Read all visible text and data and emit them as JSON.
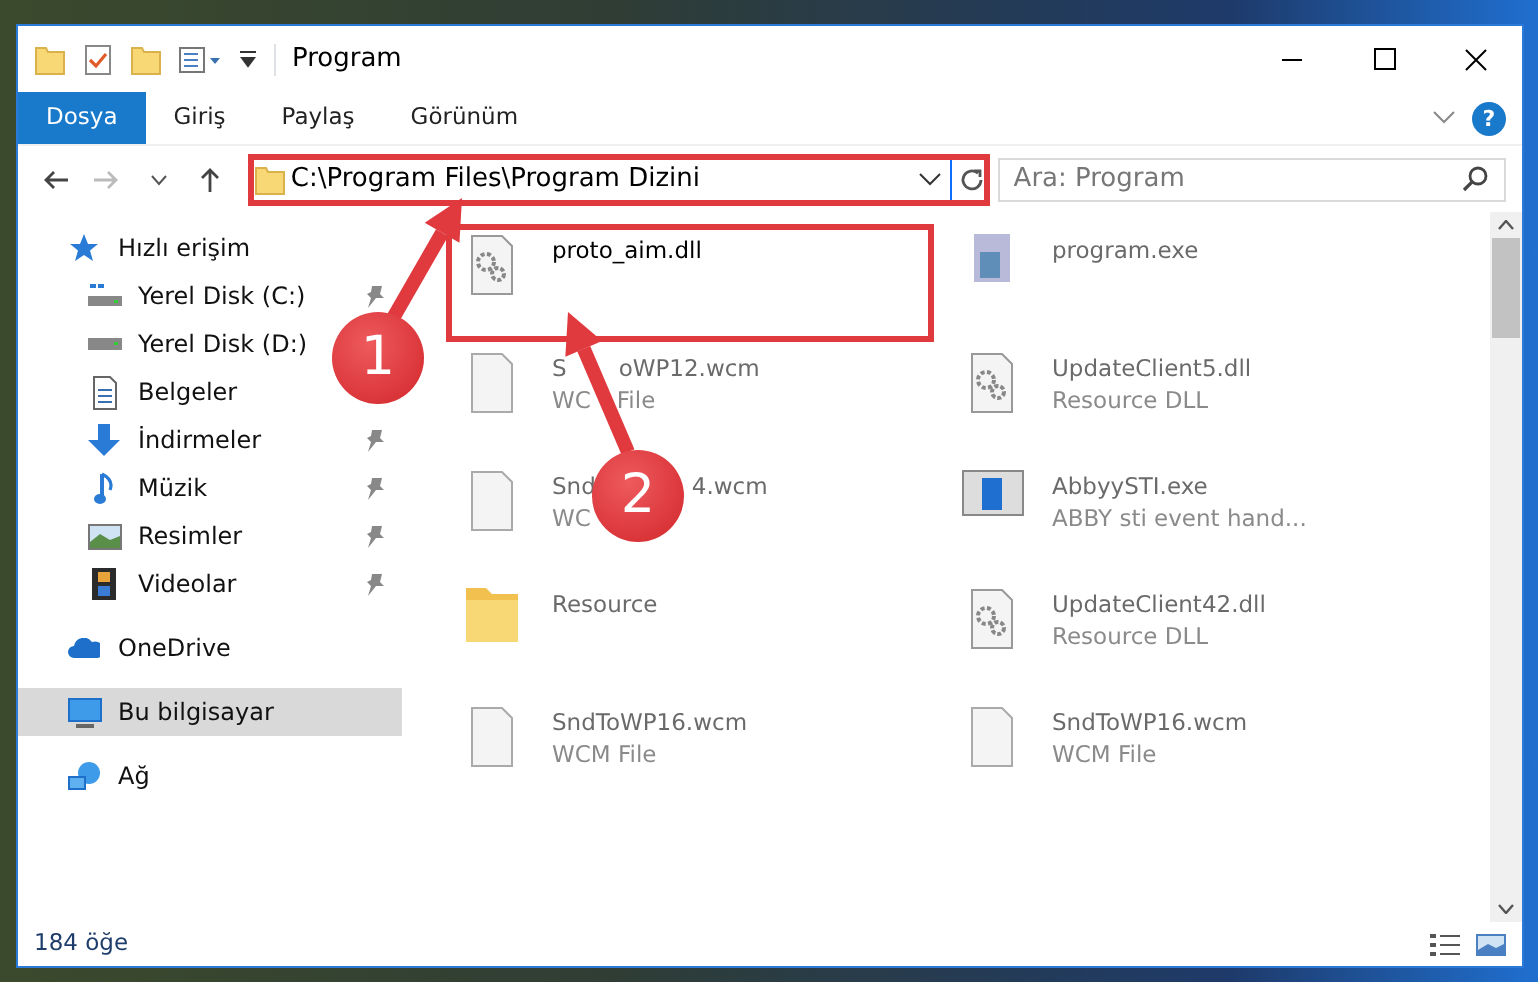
{
  "window": {
    "title": "Program"
  },
  "ribbon_tabs": [
    {
      "label": "Dosya",
      "selected": true
    },
    {
      "label": "Giriş",
      "selected": false
    },
    {
      "label": "Paylaş",
      "selected": false
    },
    {
      "label": "Görünüm",
      "selected": false
    }
  ],
  "help": "?",
  "address": {
    "value": "C:\\Program Files\\Program Dizini",
    "highlighted": true
  },
  "search": {
    "placeholder": "Ara: Program"
  },
  "sidebar": {
    "items": [
      {
        "label": "Hızlı erişim",
        "kind": "star",
        "selected": false,
        "children": [
          {
            "label": "Yerel Disk (C:)",
            "kind": "drive-c",
            "selected": false,
            "pinned": true
          },
          {
            "label": "Yerel Disk (D:)",
            "kind": "drive",
            "selected": false,
            "pinned": false
          },
          {
            "label": "Belgeler",
            "kind": "documents",
            "selected": false,
            "pinned": false
          },
          {
            "label": "İndirmeler",
            "kind": "downloads",
            "selected": false,
            "pinned": true
          },
          {
            "label": "Müzik",
            "kind": "music",
            "selected": false,
            "pinned": true
          },
          {
            "label": "Resimler",
            "kind": "pictures",
            "selected": false,
            "pinned": true
          },
          {
            "label": "Videolar",
            "kind": "videos",
            "selected": false,
            "pinned": true
          }
        ]
      },
      {
        "label": "OneDrive",
        "kind": "cloud",
        "selected": false
      },
      {
        "label": "Bu bilgisayar",
        "kind": "computer",
        "selected": true
      },
      {
        "label": "Ağ",
        "kind": "network",
        "selected": false
      }
    ]
  },
  "files": [
    {
      "name": [
        "proto_aim.dll"
      ],
      "kind": "dll",
      "highlighted": true,
      "blurred": false
    },
    {
      "name": [
        "program.exe"
      ],
      "kind": "setup",
      "highlighted": false,
      "blurred": true
    },
    {
      "name": [
        "S",
        "oWP12.wcm"
      ],
      "type": [
        "WC",
        "File"
      ],
      "kind": "blank",
      "highlighted": false,
      "blurred": true
    },
    {
      "name": [
        "UpdateClient5.dll"
      ],
      "type": [
        "Resource DLL"
      ],
      "kind": "dll",
      "highlighted": false,
      "blurred": true
    },
    {
      "name": [
        "Snd",
        "4.wcm"
      ],
      "type": [
        "WC"
      ],
      "kind": "blank",
      "highlighted": false,
      "blurred": true
    },
    {
      "name": [
        "AbbyySTI.exe"
      ],
      "type": [
        "ABBY sti event hand..."
      ],
      "kind": "app",
      "highlighted": false,
      "blurred": true
    },
    {
      "name": [
        "Resource"
      ],
      "kind": "folder",
      "highlighted": false,
      "blurred": true
    },
    {
      "name": [
        "UpdateClient42.dll"
      ],
      "type": [
        "Resource DLL"
      ],
      "kind": "dll",
      "highlighted": false,
      "blurred": true
    },
    {
      "name": [
        "SndToWP16.wcm"
      ],
      "type": [
        "WCM File"
      ],
      "kind": "blank",
      "highlighted": false,
      "blurred": true
    },
    {
      "name": [
        "SndToWP16.wcm"
      ],
      "type": [
        "WCM File"
      ],
      "kind": "blank",
      "highlighted": false,
      "blurred": true
    }
  ],
  "status_bar": {
    "count": "184 öğe"
  },
  "annotations": [
    {
      "number": "1"
    },
    {
      "number": "2"
    }
  ]
}
